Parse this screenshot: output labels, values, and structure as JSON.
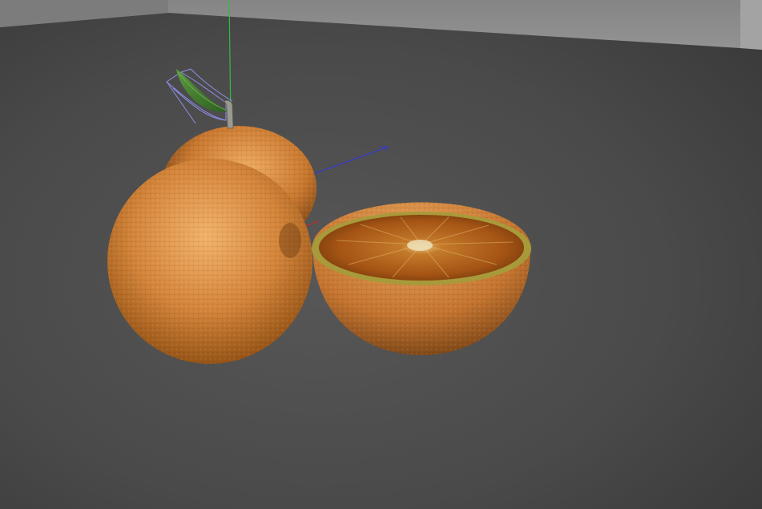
{
  "viewport": {
    "colors": {
      "floor_near": "#555555",
      "floor_far": "#3c3c3c",
      "backdrop_wall": "#8c8c8c",
      "backdrop_wall_side": "#a2a2a2",
      "orange_light": "#e39a4f",
      "orange_mid": "#c9782f",
      "orange_dark": "#6a3c12",
      "flesh": "#b9631a",
      "rind_edge": "#a89a3a",
      "leaf": "#3f7a2e",
      "stem": "#9a9a90",
      "axis_y": "#2fbf3a",
      "axis_z": "#3a3acc",
      "axis_x": "#cc2a2a",
      "selection_box": "#8f8fe8"
    },
    "objects": [
      {
        "kind": "whole-orange",
        "position": "back"
      },
      {
        "kind": "whole-orange",
        "position": "front"
      },
      {
        "kind": "half-orange",
        "position": "right"
      },
      {
        "kind": "leaf-with-stem",
        "selected": true
      }
    ],
    "gizmo": {
      "axes": [
        "x",
        "y",
        "z"
      ],
      "visible": true
    }
  }
}
